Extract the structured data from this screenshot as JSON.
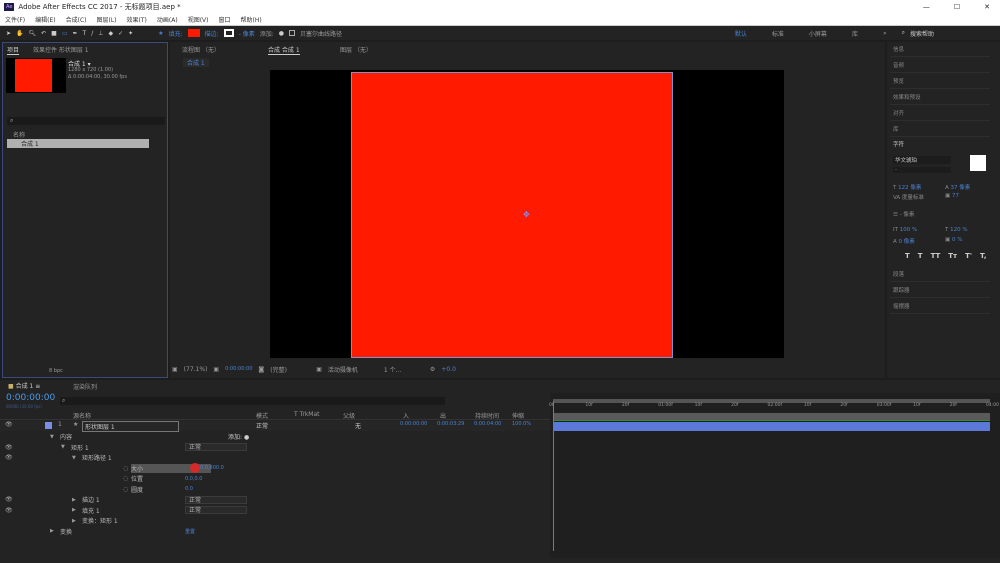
{
  "window": {
    "title": "Adobe After Effects CC 2017 - 无标题项目.aep *",
    "app_icon": "Ae",
    "minimize": "—",
    "maximize": "☐",
    "close": "✕"
  },
  "menu": [
    "文件(F)",
    "编辑(E)",
    "合成(C)",
    "图层(L)",
    "效果(T)",
    "动画(A)",
    "视图(V)",
    "窗口",
    "帮助(H)"
  ],
  "toolbar": {
    "fill_label": "填充:",
    "stroke_label": "描边:",
    "stroke_px": "- 像素",
    "add_label": "添加:",
    "bezier_label": "贝塞尔曲线路径",
    "fill_color": "#ff1a00",
    "workspaces": [
      "默认",
      "标准",
      "小屏幕",
      "库"
    ],
    "more": "»",
    "search_placeholder": "搜索帮助"
  },
  "project": {
    "tab_project": "项目",
    "tab_effects": "效果控件 形状图层 1",
    "comp_name": "合成 1 ▾",
    "comp_size": "1280 x 720 (1.00)",
    "comp_duration": "Δ 0:00:04:00, 30.00 fps",
    "col_name": "名称",
    "item": "合成 1",
    "bpc": "8 bpc"
  },
  "viewer": {
    "tab_flow": "流程图 （无）",
    "tab_comp": "合成 合成 1",
    "tab_layer": "图层 （无）",
    "breadcrumb": "合成 1",
    "zoom": "(77.1%)",
    "timecode": "0:00:00:00",
    "quality": "(完整)",
    "camera": "活动摄像机",
    "views": "1 个...",
    "exposure": "+0.0",
    "comp_color": "#ff1a00"
  },
  "right_panel": {
    "items_top": [
      "信息",
      "音频",
      "预览",
      "效果和预设",
      "对齐",
      "库"
    ],
    "character_title": "字符",
    "font": "华文琥珀",
    "font_style": "-",
    "size": "122 像素",
    "leading": "37 像素",
    "kerning": "度量标准",
    "tracking": "77",
    "stroke_width": "- 像素",
    "vscale": "100 %",
    "hscale": "120 %",
    "baseline": "0 像素",
    "tsume": "0 %",
    "styles": [
      "T",
      "T",
      "TT",
      "Tт",
      "T'",
      "T,"
    ],
    "items_bottom": [
      "段落",
      "跟踪器",
      "摇摆器"
    ]
  },
  "timeline": {
    "tab_comp": "合成 1",
    "tab_render": "渲染队列",
    "time": "0:00:00:00",
    "fps_readout": "00000 (30.00 fps)",
    "columns": {
      "source": "源名称",
      "mode": "模式",
      "trkmat": "T  TrkMat",
      "parent": "父级",
      "in": "入",
      "out": "出",
      "duration": "持续时间",
      "stretch": "伸缩"
    },
    "layer": {
      "num": "1",
      "name": "形状图层 1",
      "mode": "正常",
      "parent": "无",
      "in": "0:00:00:00",
      "out": "0:00:03:29",
      "duration": "0:00:04:00",
      "stretch": "100.0%"
    },
    "add_label": "添加:",
    "props": [
      {
        "label": "内容",
        "indent": 0,
        "value": ""
      },
      {
        "label": "矩形 1",
        "indent": 1,
        "value": "正常",
        "select": true,
        "eye": true
      },
      {
        "label": "矩形路径 1",
        "indent": 2,
        "value": "",
        "eye": true
      },
      {
        "label": "大小",
        "indent": 3,
        "value": "0.0,800.0",
        "stopwatch": true,
        "highlight": true
      },
      {
        "label": "位置",
        "indent": 3,
        "value": "0.0,0.0",
        "stopwatch": true
      },
      {
        "label": "圆度",
        "indent": 3,
        "value": "0.0",
        "stopwatch": true
      },
      {
        "label": "描边 1",
        "indent": 2,
        "value": "正常",
        "select": true,
        "eye": true
      },
      {
        "label": "填充 1",
        "indent": 2,
        "value": "正常",
        "select": true,
        "eye": true
      },
      {
        "label": "变换：矩形 1",
        "indent": 2,
        "value": ""
      },
      {
        "label": "变换",
        "indent": 0,
        "value": "重置"
      }
    ],
    "ruler": [
      "0f",
      "10f",
      "20f",
      "01:00f",
      "10f",
      "20f",
      "02:00f",
      "10f",
      "20f",
      "03:00f",
      "10f",
      "20f",
      "04:00"
    ]
  }
}
